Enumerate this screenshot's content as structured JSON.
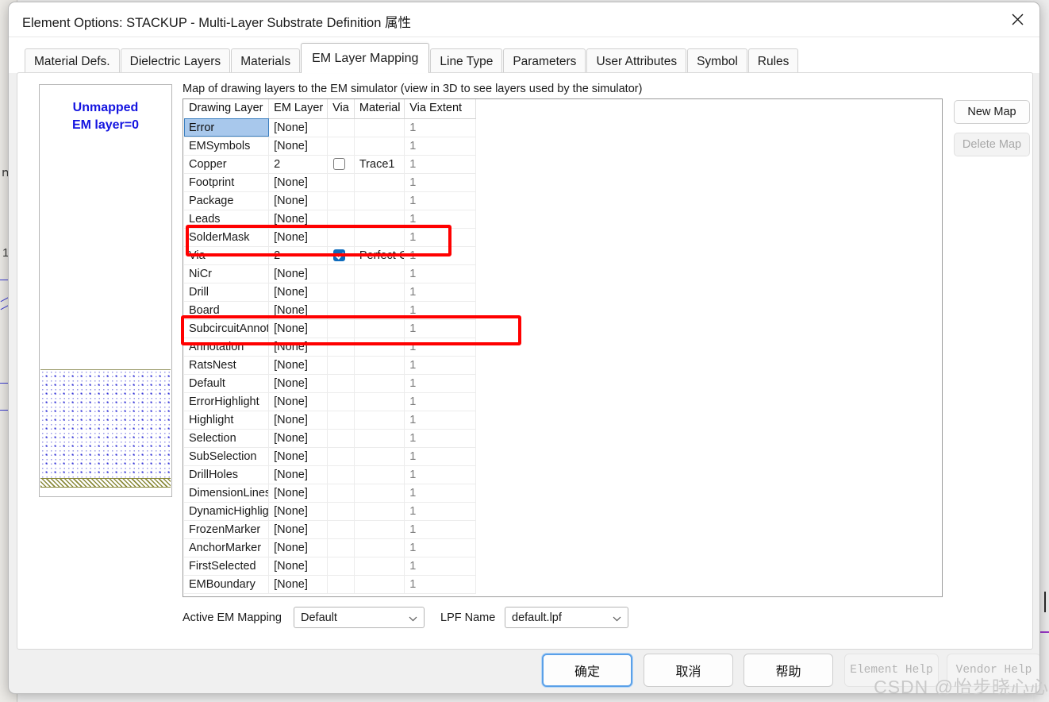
{
  "window": {
    "title": "Element Options: STACKUP - Multi-Layer Substrate Definition 属性",
    "close_icon": "close-icon"
  },
  "tabs": [
    {
      "label": "Material Defs.",
      "active": false
    },
    {
      "label": "Dielectric Layers",
      "active": false
    },
    {
      "label": "Materials",
      "active": false
    },
    {
      "label": "EM Layer Mapping",
      "active": true
    },
    {
      "label": "Line Type",
      "active": false
    },
    {
      "label": "Parameters",
      "active": false
    },
    {
      "label": "User Attributes",
      "active": false
    },
    {
      "label": "Symbol",
      "active": false
    },
    {
      "label": "Rules",
      "active": false
    }
  ],
  "preview": {
    "label": "Unmapped\nEM layer=0"
  },
  "main": {
    "description": "Map of drawing layers to the EM simulator (view in 3D to see layers used by the simulator)",
    "columns": [
      "Drawing Layer",
      "EM Layer",
      "Via",
      "Material",
      "Via Extent"
    ],
    "rows": [
      {
        "name": "Error",
        "em_layer": "[None]",
        "via": "none",
        "material": "",
        "via_extent": "1",
        "selected": true
      },
      {
        "name": "EMSymbols",
        "em_layer": "[None]",
        "via": "none",
        "material": "",
        "via_extent": "1",
        "selected": false
      },
      {
        "name": "Copper",
        "em_layer": "2",
        "via": "unchecked",
        "material": "Trace1",
        "via_extent": "1",
        "selected": false
      },
      {
        "name": "Footprint",
        "em_layer": "[None]",
        "via": "none",
        "material": "",
        "via_extent": "1",
        "selected": false
      },
      {
        "name": "Package",
        "em_layer": "[None]",
        "via": "none",
        "material": "",
        "via_extent": "1",
        "selected": false
      },
      {
        "name": "Leads",
        "em_layer": "[None]",
        "via": "none",
        "material": "",
        "via_extent": "1",
        "selected": false
      },
      {
        "name": "SolderMask",
        "em_layer": "[None]",
        "via": "none",
        "material": "",
        "via_extent": "1",
        "selected": false
      },
      {
        "name": "Via",
        "em_layer": "2",
        "via": "checked",
        "material": "Perfect C",
        "via_extent": "1",
        "selected": false
      },
      {
        "name": "NiCr",
        "em_layer": "[None]",
        "via": "none",
        "material": "",
        "via_extent": "1",
        "selected": false
      },
      {
        "name": "Drill",
        "em_layer": "[None]",
        "via": "none",
        "material": "",
        "via_extent": "1",
        "selected": false
      },
      {
        "name": "Board",
        "em_layer": "[None]",
        "via": "none",
        "material": "",
        "via_extent": "1",
        "selected": false
      },
      {
        "name": "SubcircuitAnnot",
        "em_layer": "[None]",
        "via": "none",
        "material": "",
        "via_extent": "1",
        "selected": false
      },
      {
        "name": "Annotation",
        "em_layer": "[None]",
        "via": "none",
        "material": "",
        "via_extent": "1",
        "selected": false
      },
      {
        "name": "RatsNest",
        "em_layer": "[None]",
        "via": "none",
        "material": "",
        "via_extent": "1",
        "selected": false
      },
      {
        "name": "Default",
        "em_layer": "[None]",
        "via": "none",
        "material": "",
        "via_extent": "1",
        "selected": false
      },
      {
        "name": "ErrorHighlight",
        "em_layer": "[None]",
        "via": "none",
        "material": "",
        "via_extent": "1",
        "selected": false
      },
      {
        "name": "Highlight",
        "em_layer": "[None]",
        "via": "none",
        "material": "",
        "via_extent": "1",
        "selected": false
      },
      {
        "name": "Selection",
        "em_layer": "[None]",
        "via": "none",
        "material": "",
        "via_extent": "1",
        "selected": false
      },
      {
        "name": "SubSelection",
        "em_layer": "[None]",
        "via": "none",
        "material": "",
        "via_extent": "1",
        "selected": false
      },
      {
        "name": "DrillHoles",
        "em_layer": "[None]",
        "via": "none",
        "material": "",
        "via_extent": "1",
        "selected": false
      },
      {
        "name": "DimensionLines",
        "em_layer": "[None]",
        "via": "none",
        "material": "",
        "via_extent": "1",
        "selected": false
      },
      {
        "name": "DynamicHighligh",
        "em_layer": "[None]",
        "via": "none",
        "material": "",
        "via_extent": "1",
        "selected": false
      },
      {
        "name": "FrozenMarker",
        "em_layer": "[None]",
        "via": "none",
        "material": "",
        "via_extent": "1",
        "selected": false
      },
      {
        "name": "AnchorMarker",
        "em_layer": "[None]",
        "via": "none",
        "material": "",
        "via_extent": "1",
        "selected": false
      },
      {
        "name": "FirstSelected",
        "em_layer": "[None]",
        "via": "none",
        "material": "",
        "via_extent": "1",
        "selected": false
      },
      {
        "name": "EMBoundary",
        "em_layer": "[None]",
        "via": "none",
        "material": "",
        "via_extent": "1",
        "selected": false
      }
    ]
  },
  "side_buttons": {
    "new_map": "New Map",
    "delete_map": "Delete Map"
  },
  "bottom_fields": {
    "active_mapping_label": "Active EM Mapping",
    "active_mapping_value": "Default",
    "lpf_label": "LPF Name",
    "lpf_value": "default.lpf"
  },
  "footer": {
    "ok": "确定",
    "cancel": "取消",
    "help": "帮助",
    "element_help": "Element Help",
    "vendor_help": "Vendor Help"
  },
  "watermark": "CSDN @怡步晓心心",
  "background_fragments": {
    "frag_top": "ո",
    "frag_mid": "1"
  },
  "colors": {
    "selection_blue": "#a8c8ec",
    "annotation_red": "#ff0000",
    "preview_blue": "#1414e0",
    "checkbox_blue": "#0f6cbd",
    "focus_blue": "#5aa0e8"
  }
}
